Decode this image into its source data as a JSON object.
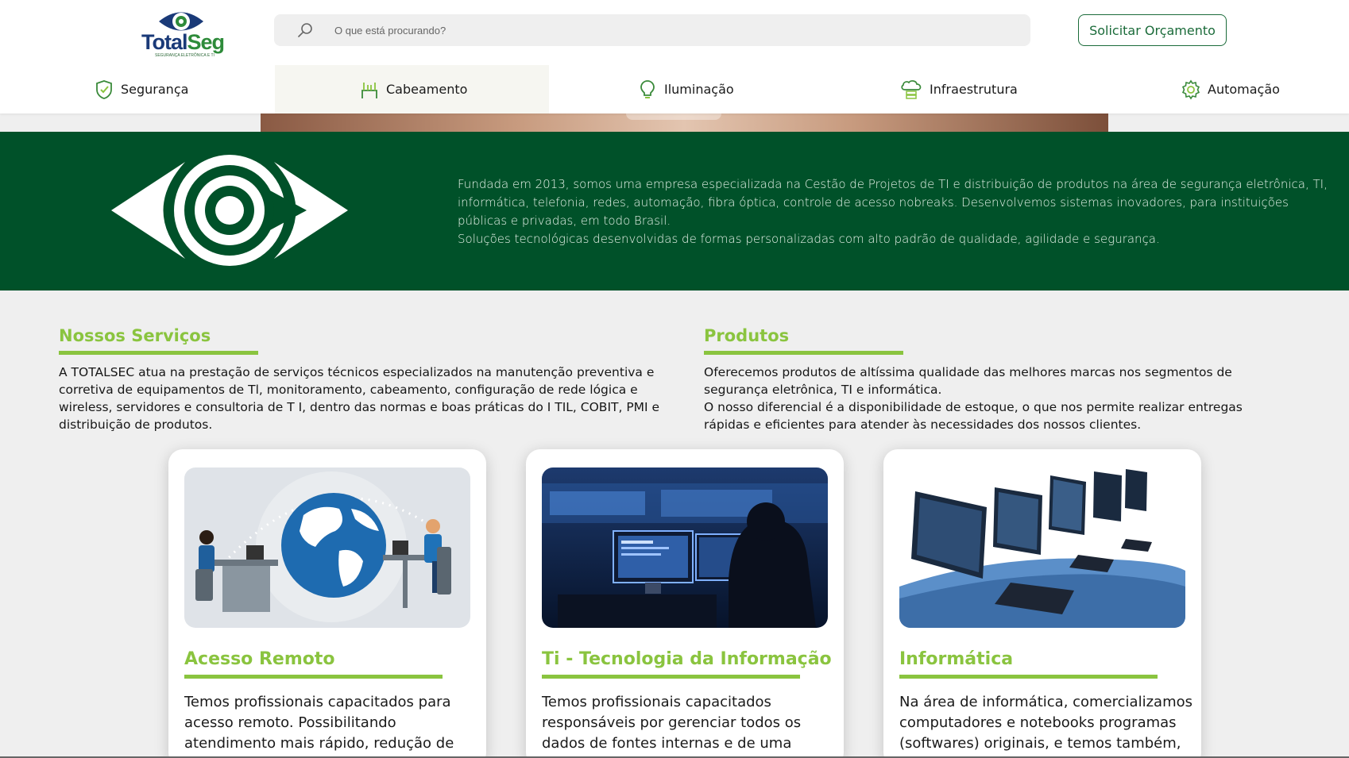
{
  "header": {
    "logo": {
      "name_part1": "Total",
      "name_part2": "Seg",
      "tagline": "SEGURANÇA ELETRÔNICA E TI"
    },
    "search": {
      "placeholder": "O que está procurando?",
      "icon": "search-icon"
    },
    "cta_label": "Solicitar Orçamento"
  },
  "nav": {
    "items": [
      {
        "label": "Segurança",
        "icon": "shield-check-icon"
      },
      {
        "label": "Cabeamento",
        "icon": "cable-connector-icon"
      },
      {
        "label": "Iluminação",
        "icon": "lightbulb-icon"
      },
      {
        "label": "Infraestrutura",
        "icon": "cloud-server-icon"
      },
      {
        "label": "Automação",
        "icon": "gear-icon"
      }
    ]
  },
  "about": {
    "logo_icon": "eye-logo-icon",
    "paragraph1": "Fundada em 2013, somos uma empresa especializada na Cestão de Projetos de TI e distribuição de produtos na área de segurança eletrônica, TI, informática, telefonia, redes, automação, fibra óptica, controle de acesso nobreaks. Desenvolvemos sistemas inovadores, para instituições públicas e privadas, em todo Brasil.",
    "paragraph2": "Soluções tecnológicas desenvolvidas de formas personalizadas com alto padrão de qualidade, agilidade e segurança."
  },
  "services": {
    "title": "Nossos Serviços",
    "text": "A TOTALSEC atua na prestação de serviços técnicos especializados na manutenção preventiva e corretiva de equipamentos de Tl, monitoramento, cabeamento, configuração de rede lógica e wireless, servidores e consultoria de T I, dentro das normas e boas práticas do I TIL, COBIT, PMI e distribuição de produtos."
  },
  "products": {
    "title": "Produtos",
    "text1": "Oferecemos produtos de altíssima qualidade das melhores marcas nos segmentos de segurança eletrônica, TI e informática.",
    "text2": "O nosso diferencial é a disponibilidade de estoque, o que nos permite realizar entregas rápidas e eficientes para atender às necessidades dos nossos clientes."
  },
  "cards": [
    {
      "title": "Acesso Remoto",
      "text": "Temos profissionais capacitados para acesso remoto. Possibilitando atendimento mais rápido, redução de"
    },
    {
      "title": "Ti - Tecnologia da Informação",
      "text": "Temos profissionais capacitados responsáveis por gerenciar todos os dados de fontes internas e de uma"
    },
    {
      "title": "Informática",
      "text": "Na área de informática, comercializamos computadores e notebooks programas (softwares) originais, e temos também,"
    }
  ],
  "colors": {
    "brand_green": "#005129",
    "accent_lime": "#8ac43f",
    "button_green": "#1b6b3a"
  }
}
